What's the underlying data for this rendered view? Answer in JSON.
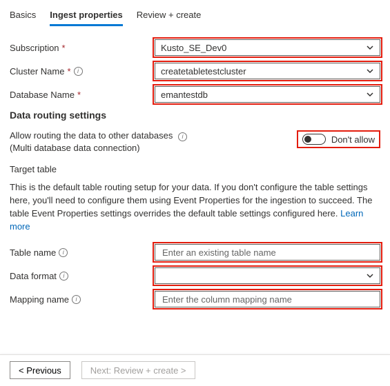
{
  "tabs": {
    "basics": "Basics",
    "ingest": "Ingest properties",
    "review": "Review + create",
    "active": "ingest"
  },
  "form": {
    "subscription": {
      "label": "Subscription",
      "value": "Kusto_SE_Dev0"
    },
    "cluster": {
      "label": "Cluster Name",
      "value": "createtabletestcluster"
    },
    "database": {
      "label": "Database Name",
      "value": "emantestdb"
    }
  },
  "routing": {
    "heading": "Data routing settings",
    "allow_label": "Allow routing the data to other databases",
    "allow_sub": "(Multi database data connection)",
    "toggle_state": "Don't allow"
  },
  "target": {
    "heading": "Target table",
    "desc_part1": "This is the default table routing setup for your data. If you don't configure the table settings here, you'll need to configure them using Event Properties for the ingestion to succeed. The table Event Properties settings overrides the default table settings configured here. ",
    "learn_more": "Learn more",
    "table_name": {
      "label": "Table name",
      "placeholder": "Enter an existing table name"
    },
    "data_format": {
      "label": "Data format",
      "value": ""
    },
    "mapping_name": {
      "label": "Mapping name",
      "placeholder": "Enter the column mapping name"
    }
  },
  "footer": {
    "previous": "< Previous",
    "next": "Next: Review + create >"
  },
  "colors": {
    "accent": "#0078d4",
    "highlight": "#e31c0d"
  }
}
